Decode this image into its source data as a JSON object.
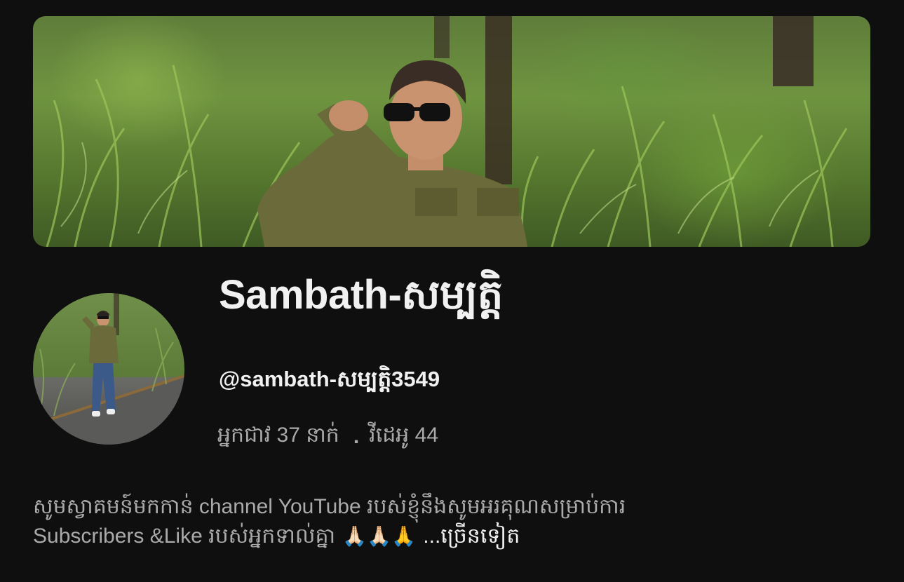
{
  "channel": {
    "name": "Sambath-សម្បត្តិ",
    "handle": "@sambath-សម្បត្តិ3549",
    "subscribers": "អ្នកជាវ 37 នាក់",
    "separator": ".",
    "videos": "វីដេអូ 44"
  },
  "description": {
    "line1": "សូមស្វាគមន៍មកកាន់ channel YouTube របស់ខ្ញុំនឹងសូមអរគុណសម្រាប់ការ",
    "line2": "Subscribers &Like របស់អ្នកទាល់គ្នា",
    "emoji": "🙏🏻🙏🏻🙏",
    "more": "...ច្រើនទៀត"
  },
  "icons": {
    "banner": "channel-banner-image",
    "avatar": "channel-avatar-image"
  },
  "colors": {
    "background": "#0f0f0f",
    "primary_text": "#f1f1f1",
    "secondary_text": "#aaaaaa"
  }
}
